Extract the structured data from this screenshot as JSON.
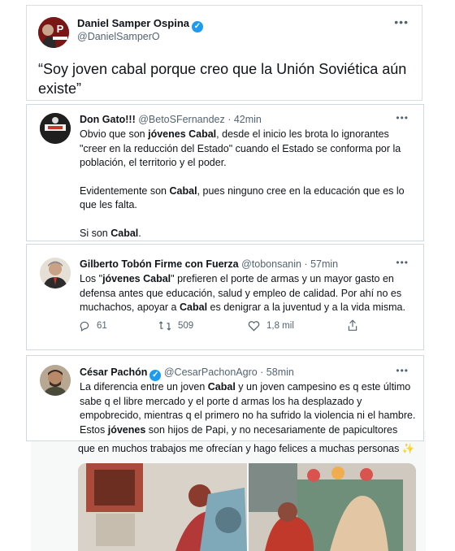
{
  "tweet1": {
    "name": "Daniel Samper Ospina",
    "handle": "@DanielSamperO",
    "avatar_label": "P",
    "text": "“Soy joven cabal porque creo que la Unión Soviética aún existe”"
  },
  "reply1": {
    "name": "Don Gato!!!",
    "handle_time": "@BetoSFernandez · 42min",
    "p1_a": "Obvio que son ",
    "p1_b": "jóvenes Cabal",
    "p1_c": ", desde el inicio les brota lo ignorantes \"creer en la reducción del Estado\" cuando el Estado se conforma por la población, el territorio y el poder.",
    "p2_a": "Evidentemente son ",
    "p2_b": "Cabal",
    "p2_c": ", pues ninguno cree en la educación que es lo que les falta.",
    "p3_a": "Si son ",
    "p3_b": "Cabal",
    "p3_c": "."
  },
  "reply2": {
    "name": "Gilberto Tobón Firme con Fuerza",
    "handle_time": "@tobonsanin · 57min",
    "t_a": "Los \"",
    "t_b": "jóvenes Cabal",
    "t_c": "\" prefieren el porte de armas y un mayor gasto en defensa antes que educación, salud y empleo de calidad. Por ahí no es muchachos, apoyar a ",
    "t_d": "Cabal",
    "t_e": " es denigrar a la juventud y a la vida misma.",
    "replies": "61",
    "retweets": "509",
    "likes": "1,8 mil"
  },
  "reply3": {
    "name": "César Pachón",
    "handle_time": "@CesarPachonAgro · 58min",
    "t_a": "La diferencia entre un joven ",
    "t_b": "Cabal",
    "t_c": " y un joven campesino es q este último sabe q el libre mercado y el porte d armas los ha desplazado y empobrecido, mientras q el primero no ha sufrido la violencia ni el hambre. Estos ",
    "t_d": "jóvenes",
    "t_e": " son hijos de Papi, y no necesariamente de papicultores"
  },
  "background_post": {
    "text": "que en muchos trabajos me ofrecían y hago felices a muchas personas",
    "emoji": "✨"
  },
  "colors": {
    "border": "#cfd9de",
    "muted": "#536471",
    "verified": "#1d9bf0"
  }
}
